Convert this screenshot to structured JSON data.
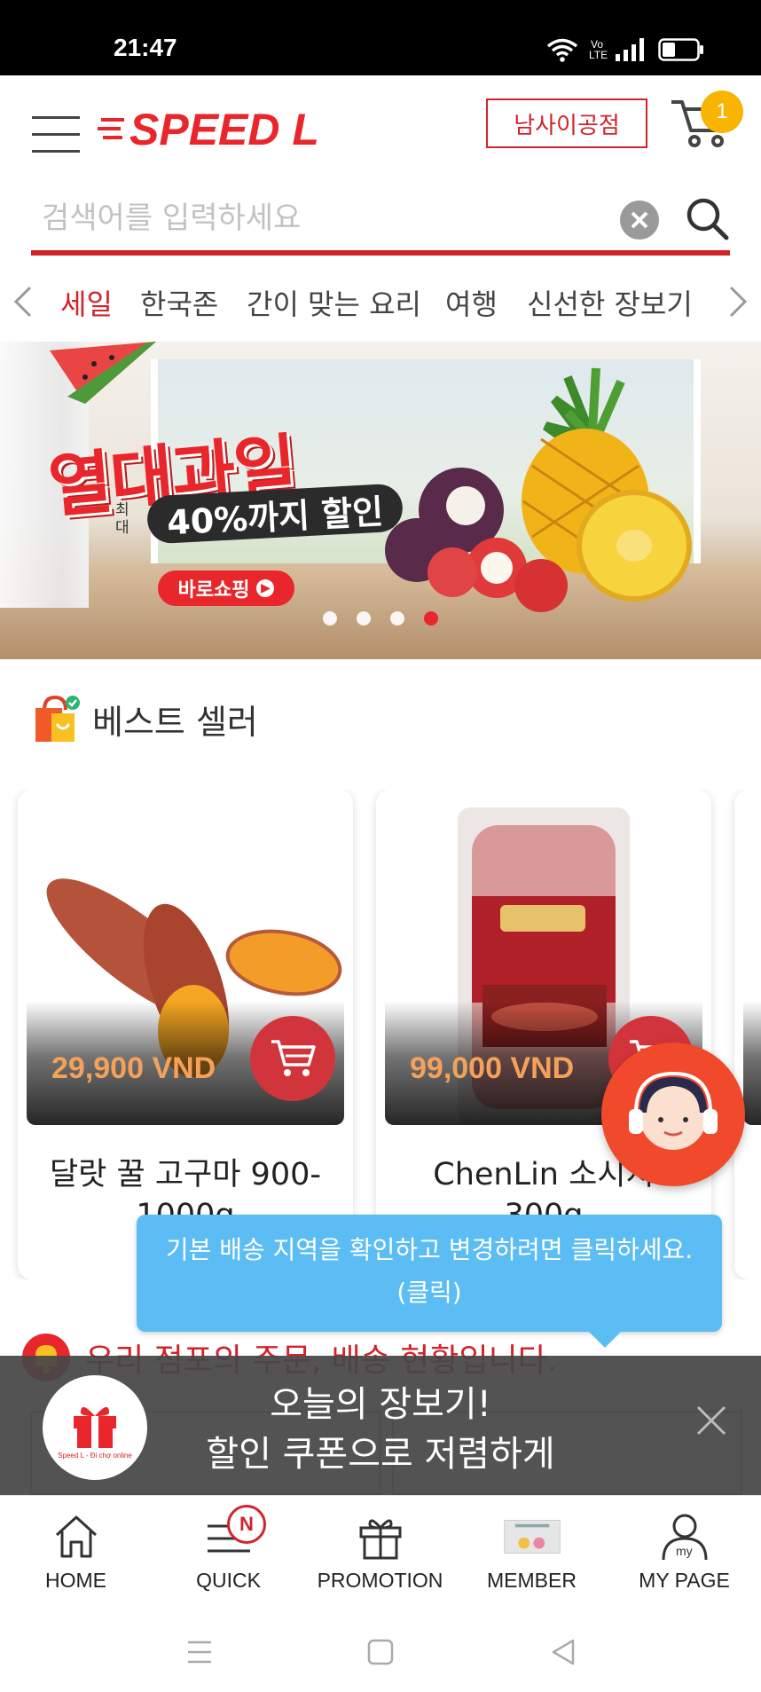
{
  "status_bar": {
    "time": "21:47",
    "network_label": "Vo LTE"
  },
  "header": {
    "logo_text": "SPEED L",
    "store_button": "남사이공점",
    "cart_count": "1"
  },
  "search": {
    "placeholder": "검색어를 입력하세요"
  },
  "categories": [
    {
      "label": "세일",
      "active": true
    },
    {
      "label": "한국존"
    },
    {
      "label": "간이 맞는 요리"
    },
    {
      "label": "여행"
    },
    {
      "label": "신선한 장보기"
    }
  ],
  "banner": {
    "title": "열대과일",
    "sub_prefix": "최대",
    "sub": "40%까지 할인",
    "button": "바로쇼핑",
    "dots_total": 4,
    "dots_active_index": 3
  },
  "best_seller": {
    "title": "베스트 셀러",
    "products": [
      {
        "price": "29,900 VND",
        "name": "달랏 꿀 고구마 900-",
        "name_line2": "1000g"
      },
      {
        "price": "99,000 VND",
        "name": "ChenLin 소시지",
        "name_line2": "300g"
      }
    ]
  },
  "tooltip": {
    "line1": "기본 배송 지역을 확인하고 변경하려면 클릭하세요.",
    "line2": "(클릭)"
  },
  "order_status": {
    "title": "우리 점포의 주문, 배송 현황입니다."
  },
  "promo": {
    "line1": "오늘의 장보기!",
    "line2": "할인 쿠폰으로 저렴하게",
    "gift_caption": "Speed L - Đi chợ online"
  },
  "bottom_nav": [
    {
      "label": "HOME",
      "icon": "home-icon"
    },
    {
      "label": "QUICK",
      "icon": "menu-icon",
      "badge": "N"
    },
    {
      "label": "PROMOTION",
      "icon": "gift-icon"
    },
    {
      "label": "MEMBER",
      "icon": "membership-card-icon"
    },
    {
      "label": "MY PAGE",
      "icon": "user-icon"
    }
  ],
  "colors": {
    "brand_red": "#d2232a",
    "badge_yellow": "#f8b400",
    "tooltip_blue": "#5bbdf3",
    "price_orange": "#f5a15a"
  }
}
